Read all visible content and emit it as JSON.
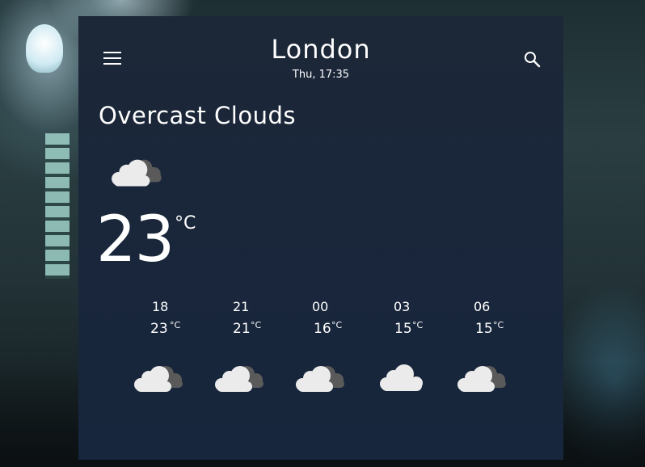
{
  "header": {
    "city": "London",
    "datetime": "Thu, 17:35",
    "menu_icon": "menu-icon",
    "search_icon": "search-icon"
  },
  "current": {
    "condition": "Overcast Clouds",
    "icon": "overcast-clouds-icon",
    "temperature": "23",
    "unit": "°C"
  },
  "hourly": [
    {
      "time": "18",
      "temp": "23",
      "unit": "°C",
      "icon": "overcast-clouds-icon"
    },
    {
      "time": "21",
      "temp": "21",
      "unit": "°C",
      "icon": "overcast-clouds-icon"
    },
    {
      "time": "00",
      "temp": "16",
      "unit": "°C",
      "icon": "overcast-clouds-icon"
    },
    {
      "time": "03",
      "temp": "15",
      "unit": "°C",
      "icon": "cloud-icon"
    },
    {
      "time": "06",
      "temp": "15",
      "unit": "°C",
      "icon": "overcast-clouds-icon"
    }
  ],
  "colors": {
    "card_background": "#1c2738",
    "text": "#ffffff",
    "cloud_light": "#e9e9e9",
    "cloud_dark": "#5a5a5a"
  }
}
